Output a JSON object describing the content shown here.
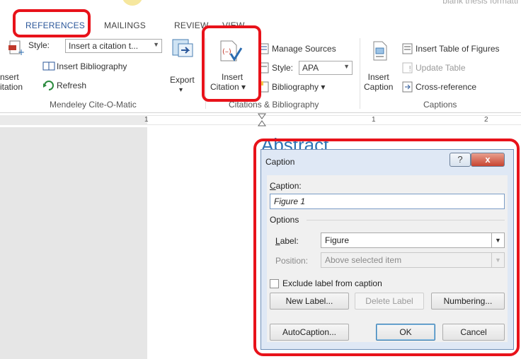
{
  "document": {
    "title_fragment": "blank thesis formatti",
    "heading": "Abstract"
  },
  "tabs": [
    {
      "label": "REFERENCES",
      "active": true
    },
    {
      "label": "MAILINGS",
      "active": false
    },
    {
      "label": "REVIEW",
      "active": false
    },
    {
      "label": "VIEW",
      "active": false
    }
  ],
  "ribbon": {
    "mendeley": {
      "group_label": "Mendeley Cite-O-Matic",
      "insert_label_1": "nsert",
      "insert_label_2": "itation",
      "style_label": "Style:",
      "style_value": "Insert a citation t...",
      "insert_bibliography": "Insert Bibliography",
      "refresh": "Refresh",
      "export": "Export",
      "export_arrow": "▾"
    },
    "citations": {
      "group_label": "Citations & Bibliography",
      "insert_citation_1": "Insert",
      "insert_citation_2": "Citation ▾",
      "manage_sources": "Manage Sources",
      "style_label": "Style:",
      "style_value": "APA",
      "bibliography": "Bibliography ▾"
    },
    "captions": {
      "group_label": "Captions",
      "insert_caption_1": "Insert",
      "insert_caption_2": "Caption",
      "insert_table_of_figures": "Insert Table of Figures",
      "update_table": "Update Table",
      "cross_reference": "Cross-reference"
    }
  },
  "ruler": {
    "mark_1": "1",
    "mark_center": "1",
    "mark_2": "2"
  },
  "dialog": {
    "title": "Caption",
    "help_button": "?",
    "close_button": "x",
    "caption_label": "Caption:",
    "caption_value": "Figure 1",
    "options_label": "Options",
    "label_label": "Label:",
    "label_value": "Figure",
    "position_label": "Position:",
    "position_value": "Above selected item",
    "exclude_label": "Exclude label from caption",
    "new_label_button": "New Label...",
    "delete_label_button": "Delete Label",
    "numbering_button": "Numbering...",
    "autocaption_button": "AutoCaption...",
    "ok_button": "OK",
    "cancel_button": "Cancel"
  },
  "colors": {
    "highlight": "#e8121a",
    "accent": "#2b579a",
    "heading": "#2e74b5"
  }
}
